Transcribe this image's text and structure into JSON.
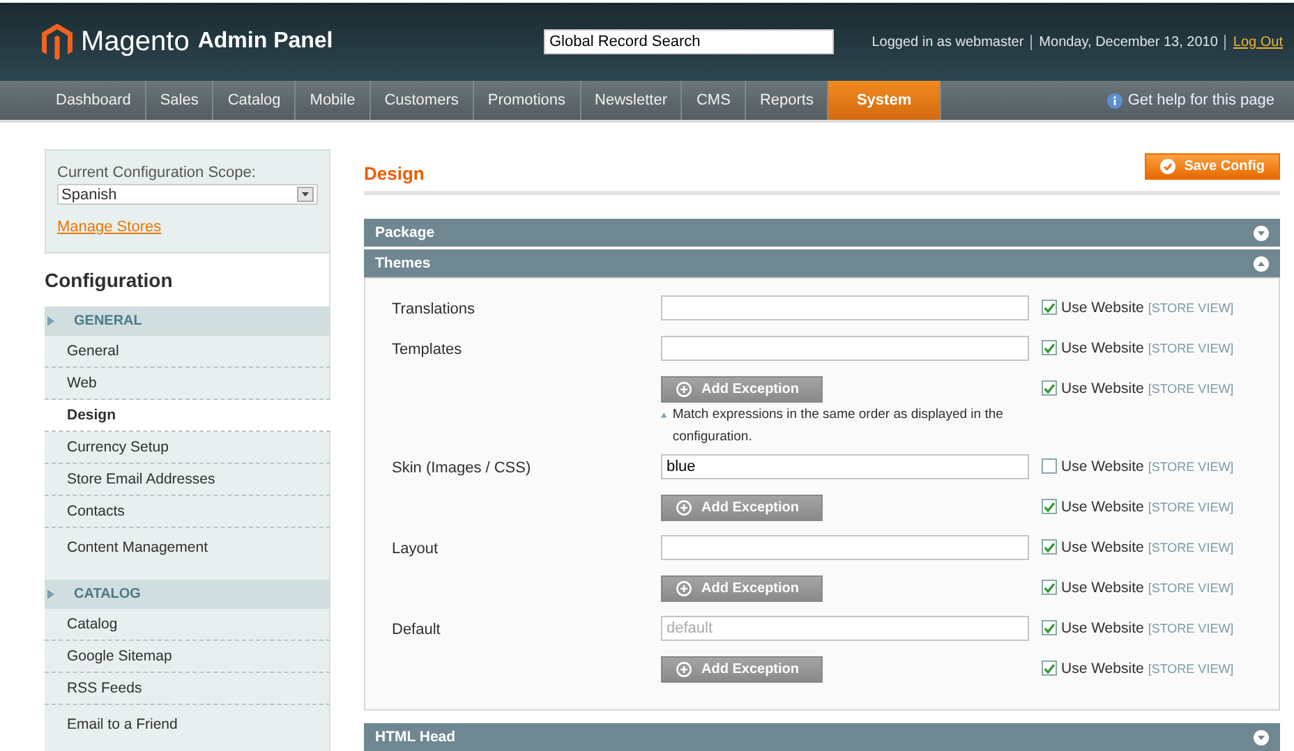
{
  "header": {
    "logo": "Magento",
    "logo_suffix": "Admin Panel",
    "search": {
      "value": "Global Record Search"
    },
    "user_info": "Logged in as webmaster",
    "date": "Monday, December 13, 2010",
    "logout": "Log Out"
  },
  "nav": {
    "items": [
      {
        "label": "Dashboard",
        "selected": false
      },
      {
        "label": "Sales",
        "selected": false
      },
      {
        "label": "Catalog",
        "selected": false
      },
      {
        "label": "Mobile",
        "selected": false
      },
      {
        "label": "Customers",
        "selected": false
      },
      {
        "label": "Promotions",
        "selected": false
      },
      {
        "label": "Newsletter",
        "selected": false
      },
      {
        "label": "CMS",
        "selected": false
      },
      {
        "label": "Reports",
        "selected": false
      },
      {
        "label": "System",
        "selected": true
      }
    ],
    "help": "Get help for this page"
  },
  "sidebar": {
    "scope_label": "Current Configuration Scope:",
    "scope_value": "Spanish",
    "manage_stores": "Manage Stores",
    "title": "Configuration",
    "sections": [
      {
        "title": "GENERAL",
        "items": [
          {
            "label": "General",
            "selected": false
          },
          {
            "label": "Web",
            "selected": false
          },
          {
            "label": "Design",
            "selected": true
          },
          {
            "label": "Currency Setup",
            "selected": false
          },
          {
            "label": "Store Email Addresses",
            "selected": false
          },
          {
            "label": "Contacts",
            "selected": false
          },
          {
            "label": "Content Management",
            "selected": false
          }
        ]
      },
      {
        "title": "CATALOG",
        "items": [
          {
            "label": "Catalog",
            "selected": false
          },
          {
            "label": "Google Sitemap",
            "selected": false
          },
          {
            "label": "RSS Feeds",
            "selected": false
          },
          {
            "label": "Email to a Friend",
            "selected": false
          }
        ]
      }
    ]
  },
  "main": {
    "title": "Design",
    "save_button": "Save Config",
    "groups": [
      {
        "title": "Package",
        "expanded": false
      },
      {
        "title": "Themes",
        "expanded": true,
        "rows": [
          {
            "kind": "field",
            "label": "Translations",
            "value": "",
            "use_website": true,
            "checkbox_label": "Use Website",
            "scope": "[STORE VIEW]"
          },
          {
            "kind": "field",
            "label": "Templates",
            "value": "",
            "use_website": true,
            "checkbox_label": "Use Website",
            "scope": "[STORE VIEW]"
          },
          {
            "kind": "exception",
            "button": "Add Exception",
            "note": "Match expressions in the same order as displayed in the configuration.",
            "use_website": true,
            "checkbox_label": "Use Website",
            "scope": "[STORE VIEW]"
          },
          {
            "kind": "field",
            "label": "Skin (Images / CSS)",
            "value": "blue",
            "use_website": false,
            "checkbox_label": "Use Website",
            "scope": "[STORE VIEW]"
          },
          {
            "kind": "exception",
            "button": "Add Exception",
            "use_website": true,
            "checkbox_label": "Use Website",
            "scope": "[STORE VIEW]"
          },
          {
            "kind": "field",
            "label": "Layout",
            "value": "",
            "use_website": true,
            "checkbox_label": "Use Website",
            "scope": "[STORE VIEW]"
          },
          {
            "kind": "exception",
            "button": "Add Exception",
            "use_website": true,
            "checkbox_label": "Use Website",
            "scope": "[STORE VIEW]"
          },
          {
            "kind": "field",
            "label": "Default",
            "placeholder": "default",
            "value": "",
            "use_website": true,
            "checkbox_label": "Use Website",
            "scope": "[STORE VIEW]"
          },
          {
            "kind": "exception",
            "button": "Add Exception",
            "use_website": true,
            "checkbox_label": "Use Website",
            "scope": "[STORE VIEW]"
          }
        ]
      },
      {
        "title": "HTML Head",
        "expanded": false
      }
    ]
  }
}
